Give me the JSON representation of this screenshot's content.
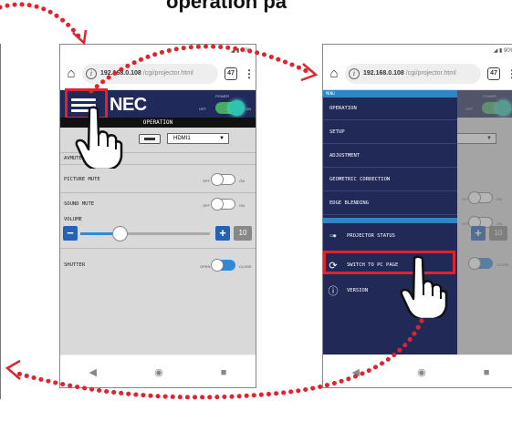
{
  "top_title": "operation pa",
  "browser": {
    "url_host": "192.168.0.108",
    "url_rest": "/cgi/projector.html",
    "tab_count": "47",
    "more_label": "⋮",
    "home_label": "⌂"
  },
  "left_phone": {
    "status": "◢ ▮ 90%",
    "brand": "NEC",
    "power_label": "POWER",
    "power_off": "OFF",
    "power_on": "ON",
    "page_title": "OPERATION",
    "input_selected": "HDMI1",
    "avmute_label": "AVMUTE",
    "picture_mute_label": "PICTURE MUTE",
    "sound_mute_label": "SOUND MUTE",
    "off_label": "OFF",
    "on_label": "ON",
    "volume_label": "VOLUME",
    "volume_minus": "−",
    "volume_plus": "+",
    "volume_value": "10",
    "volume_level": 0.3,
    "shutter_label": "SHUTTER",
    "open_label": "OPEN",
    "close_label": "CLOSE"
  },
  "right_phone": {
    "status": "◢ ▮ 90%",
    "menu_title": "MENU",
    "menu_items": [
      "OPERATION",
      "SETUP",
      "ADJUSTMENT",
      "GEOMETRIC CORRECTION",
      "EDGE BLENDING"
    ],
    "projector_status": "PROJECTOR STATUS",
    "switch_pc": "SWITCH TO PC PAGE",
    "version": "VERSION",
    "bg_power": "POWER",
    "bg_off": "OFF",
    "bg_on": "ON",
    "bg_volume_plus": "+",
    "bg_volume_value": "10",
    "bg_close": "CLOSE"
  },
  "nav": {
    "back": "◀",
    "home": "◉",
    "recent": "■"
  },
  "colors": {
    "header": "#1f2a5a",
    "accent_blue": "#2e8ad8",
    "highlight_red": "#e0242e",
    "arrow_red": "#e0242e"
  }
}
